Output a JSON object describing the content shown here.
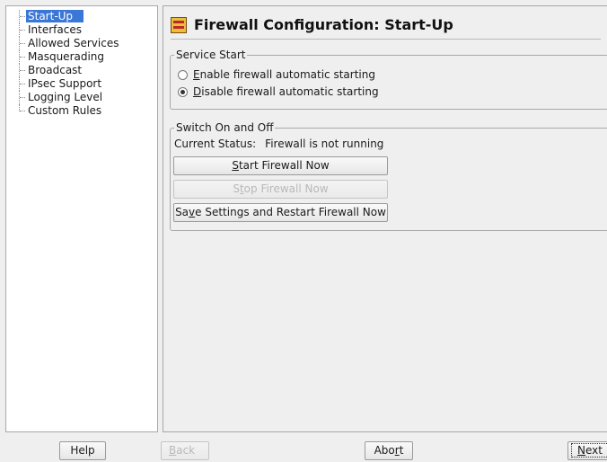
{
  "sidebar": {
    "items": [
      {
        "label": "Start-Up",
        "selected": true
      },
      {
        "label": "Interfaces"
      },
      {
        "label": "Allowed Services"
      },
      {
        "label": "Masquerading"
      },
      {
        "label": "Broadcast"
      },
      {
        "label": "IPsec Support"
      },
      {
        "label": "Logging Level"
      },
      {
        "label": "Custom Rules"
      }
    ]
  },
  "header": {
    "title": "Firewall Configuration: Start-Up",
    "icon": "firewall-icon"
  },
  "service_start": {
    "legend": "Service Start",
    "options": [
      {
        "mnemonic": "E",
        "rest": "nable firewall automatic starting",
        "checked": false
      },
      {
        "mnemonic": "D",
        "rest": "isable firewall automatic starting",
        "checked": true
      }
    ]
  },
  "switch": {
    "legend": "Switch On and Off",
    "status_label": "Current Status:",
    "status_value": "Firewall is not running",
    "start_button": {
      "mnemonic": "S",
      "rest": "tart Firewall Now"
    },
    "stop_button": {
      "pre": "S",
      "mnemonic": "t",
      "rest": "op Firewall Now",
      "enabled": false
    },
    "save_button": {
      "pre": "Sa",
      "mnemonic": "v",
      "rest": "e Settings and Restart Firewall Now"
    }
  },
  "footer": {
    "help": "Help",
    "back": {
      "mnemonic": "B",
      "rest": "ack",
      "enabled": false
    },
    "abort": {
      "pre": "Abo",
      "mnemonic": "r",
      "rest": "t"
    },
    "next": {
      "mnemonic": "N",
      "rest": "ext"
    }
  },
  "colors": {
    "selection": "#3b77d6",
    "background": "#efefef"
  }
}
